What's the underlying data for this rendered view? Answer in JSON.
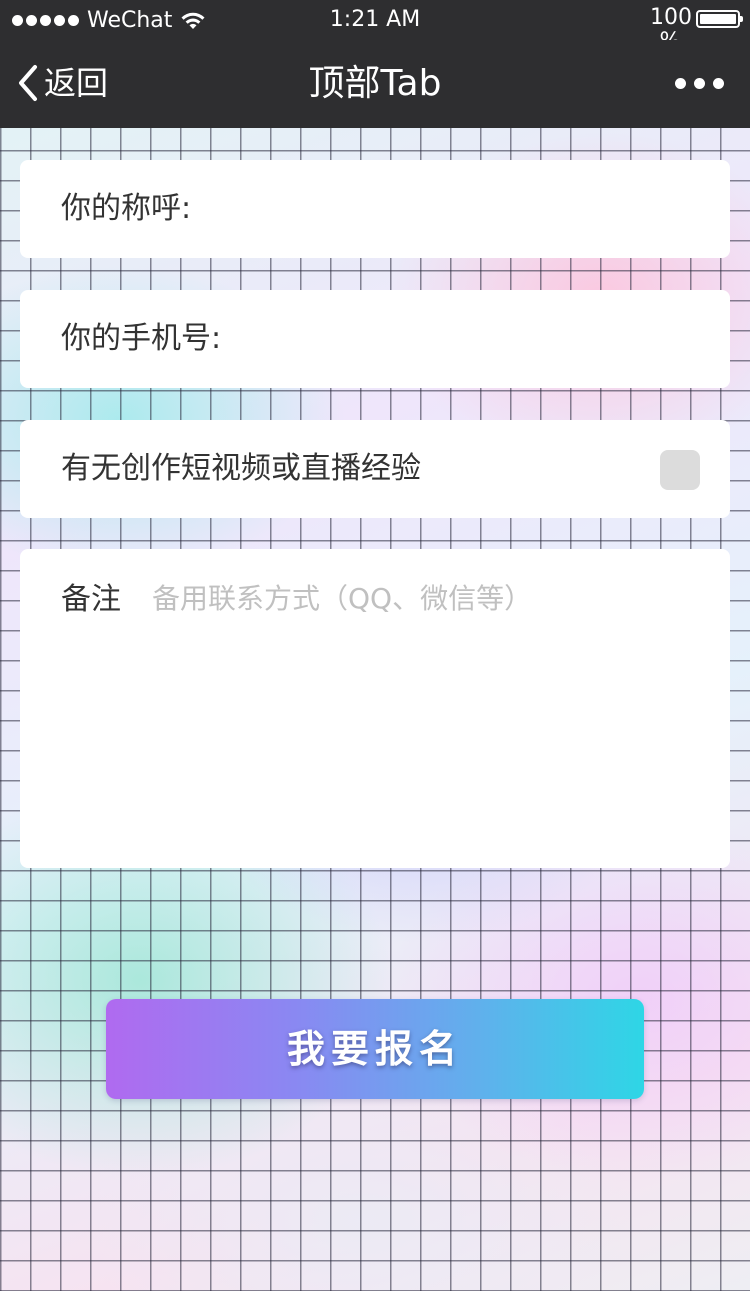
{
  "status_bar": {
    "carrier": "WeChat",
    "time": "1:21 AM",
    "battery_text": "100 %",
    "icons": [
      "signal-dots-icon",
      "wifi-icon",
      "battery-icon"
    ]
  },
  "nav": {
    "back_label": "返回",
    "title": "顶部Tab",
    "more_icon": "more-icon"
  },
  "form": {
    "name_label": "你的称呼:",
    "name_value": "",
    "phone_label": "你的手机号:",
    "phone_value": "",
    "experience_label": "有无创作短视频或直播经验",
    "experience_checked": false,
    "notes_label": "备注",
    "notes_placeholder": "备用联系方式（QQ、微信等）",
    "notes_value": ""
  },
  "submit_label": "我要报名",
  "colors": {
    "bar_background": "#2e2e30",
    "card_background": "#ffffff",
    "label_text": "#333333",
    "placeholder_text": "#c0c0c0",
    "checkbox_fill": "#dcdcdc",
    "button_gradient_start": "#b06af0",
    "button_gradient_end": "#2ed6e6"
  }
}
